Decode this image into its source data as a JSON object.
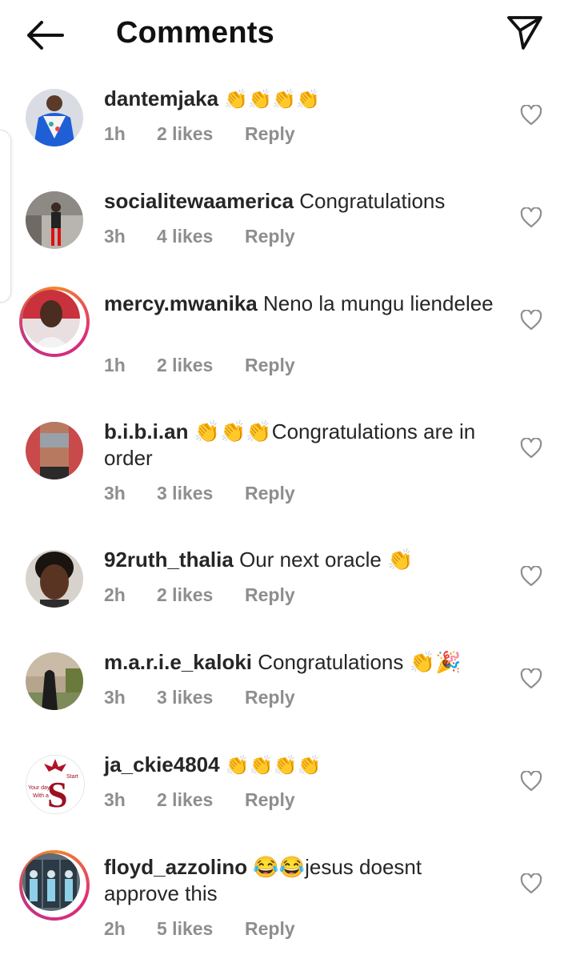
{
  "header": {
    "title": "Comments"
  },
  "comments": [
    {
      "username": "dantemjaka",
      "text": "👏👏👏👏",
      "time": "1h",
      "likes": "2 likes",
      "reply": "Reply"
    },
    {
      "username": "socialitewaamerica",
      "text": "Congratulations",
      "time": "3h",
      "likes": "4 likes",
      "reply": "Reply"
    },
    {
      "username": "mercy.mwanika",
      "text": "Neno la mungu liendelee",
      "time": "1h",
      "likes": "2 likes",
      "reply": "Reply"
    },
    {
      "username": "b.i.b.i.an",
      "text": "👏👏👏Congratulations are in order",
      "time": "3h",
      "likes": "3 likes",
      "reply": "Reply"
    },
    {
      "username": "92ruth_thalia",
      "text": "Our next oracle 👏",
      "time": "2h",
      "likes": "2 likes",
      "reply": "Reply"
    },
    {
      "username": "m.a.r.i.e_kaloki",
      "text": "Congratulations 👏🎉",
      "time": "3h",
      "likes": "3 likes",
      "reply": "Reply"
    },
    {
      "username": "ja_ckie4804",
      "text": "👏👏👏👏",
      "time": "3h",
      "likes": "2 likes",
      "reply": "Reply",
      "avatar_text": [
        "Start",
        "Your day",
        "With a"
      ]
    },
    {
      "username": "floyd_azzolino",
      "text": "😂😂jesus doesnt approve this",
      "time": "2h",
      "likes": "5 likes",
      "reply": "Reply"
    }
  ],
  "colors": {
    "text": "#262626",
    "meta": "#8e8e8e",
    "story_ring_start": "#f58529",
    "story_ring_end": "#dd2a7b"
  },
  "icons": {
    "back": "arrow-left-icon",
    "send": "paper-plane-icon",
    "like": "heart-outline-icon"
  }
}
